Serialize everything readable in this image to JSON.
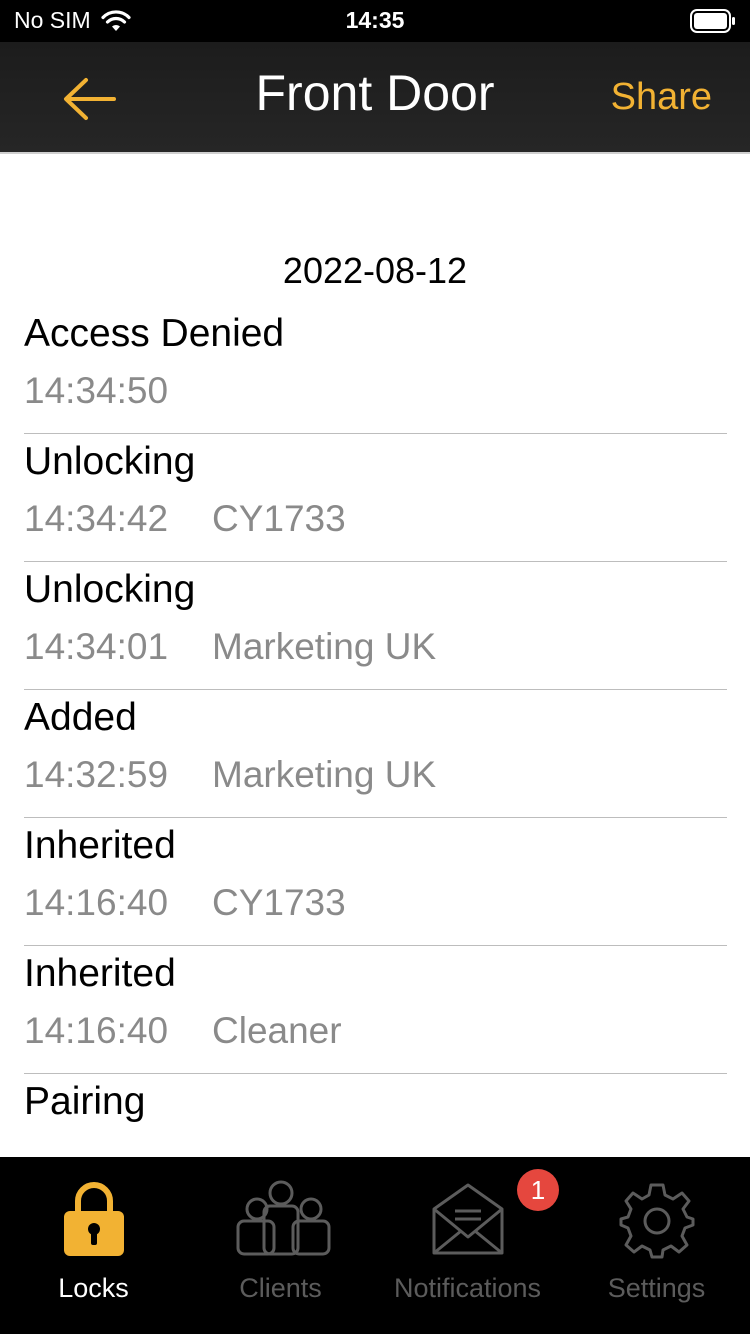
{
  "status_bar": {
    "carrier": "No SIM",
    "time": "14:35"
  },
  "nav": {
    "title": "Front Door",
    "share_label": "Share"
  },
  "log": {
    "date": "2022-08-12",
    "entries": [
      {
        "event": "Access Denied",
        "time": "14:34:50",
        "user": ""
      },
      {
        "event": "Unlocking",
        "time": "14:34:42",
        "user": "CY1733"
      },
      {
        "event": "Unlocking",
        "time": "14:34:01",
        "user": "Marketing UK"
      },
      {
        "event": "Added",
        "time": "14:32:59",
        "user": "Marketing UK"
      },
      {
        "event": "Inherited",
        "time": "14:16:40",
        "user": "CY1733"
      },
      {
        "event": "Inherited",
        "time": "14:16:40",
        "user": "Cleaner"
      },
      {
        "event": "Pairing",
        "time": "",
        "user": ""
      }
    ]
  },
  "tabs": [
    {
      "label": "Locks",
      "icon": "lock-icon",
      "active": true
    },
    {
      "label": "Clients",
      "icon": "clients-icon",
      "active": false
    },
    {
      "label": "Notifications",
      "icon": "envelope-icon",
      "active": false,
      "badge": "1"
    },
    {
      "label": "Settings",
      "icon": "gear-icon",
      "active": false
    }
  ],
  "colors": {
    "accent": "#f2b233",
    "inactive_tab": "#5c5c5c",
    "badge": "#e5473e",
    "secondary_text": "#8a8a8a"
  }
}
